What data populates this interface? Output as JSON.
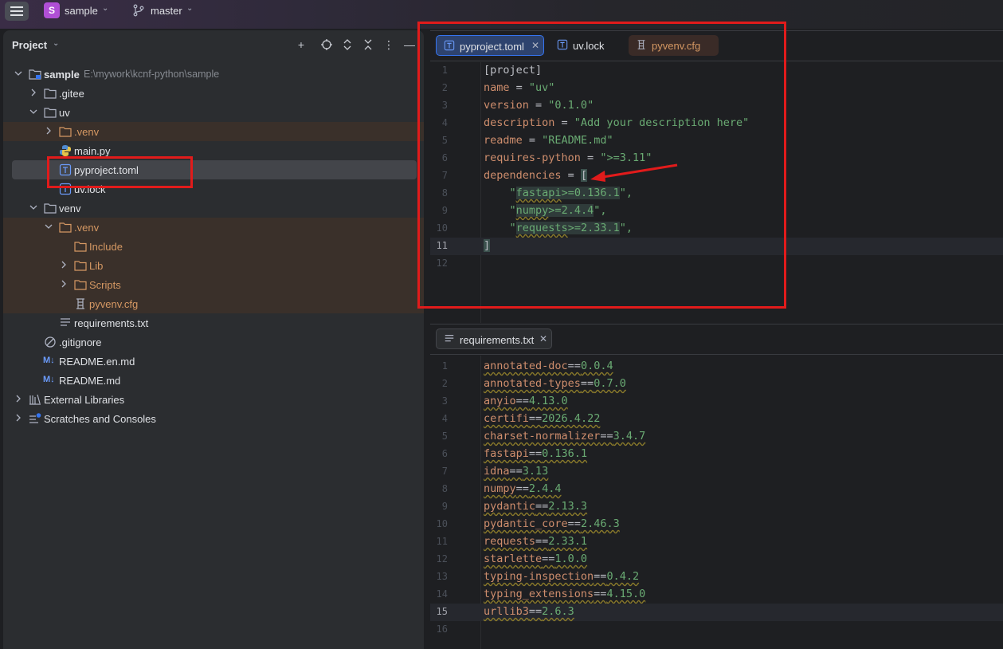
{
  "topbar": {
    "project_badge": "S",
    "project_name": "sample",
    "branch_name": "master"
  },
  "project_panel": {
    "title": "Project",
    "tree": [
      {
        "label": "sample",
        "path": "E:\\mywork\\kcnf-python\\sample"
      },
      {
        "label": ".gitee"
      },
      {
        "label": "uv"
      },
      {
        "label": ".venv"
      },
      {
        "label": "main.py"
      },
      {
        "label": "pyproject.toml"
      },
      {
        "label": "uv.lock"
      },
      {
        "label": "venv"
      },
      {
        "label": ".venv"
      },
      {
        "label": "Include"
      },
      {
        "label": "Lib"
      },
      {
        "label": "Scripts"
      },
      {
        "label": "pyvenv.cfg"
      },
      {
        "label": "requirements.txt"
      },
      {
        "label": ".gitignore"
      },
      {
        "label": "README.en.md"
      },
      {
        "label": "README.md"
      },
      {
        "label": "External Libraries"
      },
      {
        "label": "Scratches and Consoles"
      }
    ]
  },
  "editor_top": {
    "tabs": [
      {
        "label": "pyproject.toml",
        "active": true
      },
      {
        "label": "uv.lock",
        "active": false
      },
      {
        "label": "pyvenv.cfg",
        "active": false
      }
    ],
    "line_numbers": [
      "1",
      "2",
      "3",
      "4",
      "5",
      "6",
      "7",
      "8",
      "9",
      "10",
      "11",
      "12"
    ],
    "lines": {
      "l1": "[project]",
      "l2_key": "name",
      "l2_eq": " = ",
      "l2_val": "\"uv\"",
      "l3_key": "version",
      "l3_eq": " = ",
      "l3_val": "\"0.1.0\"",
      "l4_key": "description",
      "l4_eq": " = ",
      "l4_val": "\"Add your description here\"",
      "l5_key": "readme",
      "l5_eq": " = ",
      "l5_val": "\"README.md\"",
      "l6_key": "requires-python",
      "l6_eq": " = ",
      "l6_val": "\">=3.11\"",
      "l7_key": "dependencies",
      "l7_eq": " = ",
      "l7_val": "[",
      "l8_q": "\"",
      "l8_name": "fastapi",
      "l8_op": ">=",
      "l8_ver": "0.136.1",
      "l8_end": "\",",
      "l9_q": "\"",
      "l9_name": "numpy",
      "l9_op": ">=",
      "l9_ver": "2.4.4",
      "l9_end": "\",",
      "l10_q": "\"",
      "l10_name": "requests",
      "l10_op": ">=",
      "l10_ver": "2.33.1",
      "l10_end": "\",",
      "l11": "]"
    }
  },
  "editor_bottom": {
    "tabs": [
      {
        "label": "requirements.txt",
        "active": false
      }
    ],
    "line_numbers": [
      "1",
      "2",
      "3",
      "4",
      "5",
      "6",
      "7",
      "8",
      "9",
      "10",
      "11",
      "12",
      "13",
      "14",
      "15",
      "16"
    ],
    "requirements": [
      {
        "name": "annotated-doc",
        "op": "==",
        "ver": "0.0.4"
      },
      {
        "name": "annotated-types",
        "op": "==",
        "ver": "0.7.0"
      },
      {
        "name": "anyio",
        "op": "==",
        "ver": "4.13.0"
      },
      {
        "name": "certifi",
        "op": "==",
        "ver": "2026.4.22"
      },
      {
        "name": "charset-normalizer",
        "op": "==",
        "ver": "3.4.7"
      },
      {
        "name": "fastapi",
        "op": "==",
        "ver": "0.136.1"
      },
      {
        "name": "idna",
        "op": "==",
        "ver": "3.13"
      },
      {
        "name": "numpy",
        "op": "==",
        "ver": "2.4.4"
      },
      {
        "name": "pydantic",
        "op": "==",
        "ver": "2.13.3"
      },
      {
        "name": "pydantic_core",
        "op": "==",
        "ver": "2.46.3"
      },
      {
        "name": "requests",
        "op": "==",
        "ver": "2.33.1"
      },
      {
        "name": "starlette",
        "op": "==",
        "ver": "1.0.0"
      },
      {
        "name": "typing-inspection",
        "op": "==",
        "ver": "0.4.2"
      },
      {
        "name": "typing_extensions",
        "op": "==",
        "ver": "4.15.0"
      },
      {
        "name": "urllib3",
        "op": "==",
        "ver": "2.6.3"
      }
    ]
  },
  "colors": {
    "accent": "#3574f0",
    "annotation_red": "#e11b1b",
    "string_green": "#6aab73",
    "keyword_orange": "#cf8e6d"
  }
}
